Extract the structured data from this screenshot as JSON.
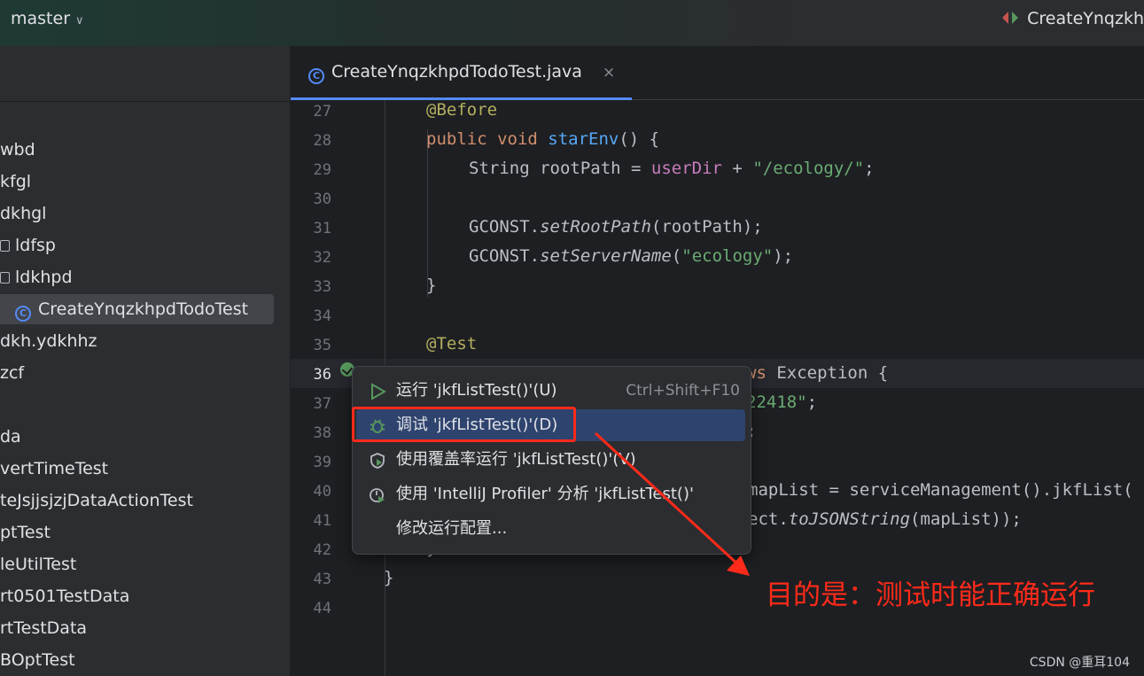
{
  "topbar": {
    "branch": "master",
    "run_config": "CreateYnqzkh"
  },
  "sidebar": {
    "items": [
      {
        "label": "wbd"
      },
      {
        "label": "kfgl"
      },
      {
        "label": "dkhgl"
      },
      {
        "label": "ldfsp"
      },
      {
        "label": "ldkhpd"
      },
      {
        "label": "CreateYnqzkhpdTodoTest",
        "selected": true
      },
      {
        "label": "dkh.ydkhhz"
      },
      {
        "label": "zcf"
      },
      {
        "label": "da"
      },
      {
        "label": "vertTimeTest"
      },
      {
        "label": "teJsjjsjzjDataActionTest"
      },
      {
        "label": "ptTest"
      },
      {
        "label": "leUtilTest"
      },
      {
        "label": "rt0501TestData"
      },
      {
        "label": "rtTestData"
      },
      {
        "label": "BOptTest"
      }
    ]
  },
  "tab": {
    "label": "CreateYnqzkhpdTodoTest.java",
    "close": "×"
  },
  "editor": {
    "line_numbers": [
      "27",
      "28",
      "29",
      "30",
      "31",
      "32",
      "33",
      "34",
      "35",
      "36",
      "37",
      "38",
      "39",
      "40",
      "41",
      "42",
      "43",
      "44"
    ],
    "line27": {
      "ann": "@Before"
    },
    "line28": {
      "kw": "public void ",
      "fn": "starEnv",
      "rest": "() {"
    },
    "line29": {
      "a": "String rootPath = ",
      "fld": "userDir",
      "b": " + ",
      "str": "\"/ecology/\"",
      "c": ";"
    },
    "line31": {
      "a": "GCONST.",
      "it": "setRootPath",
      "b": "(rootPath);"
    },
    "line32": {
      "a": "GCONST.",
      "it": "setServerName",
      "b": "(",
      "str": "\"ecology\"",
      "c": ");"
    },
    "line33": {
      "a": "}"
    },
    "line35": {
      "ann": "@Test"
    },
    "line36": {
      "kw": "ws ",
      "b": "Exception {"
    },
    "line37": {
      "str": "22418\"",
      "c": ";"
    },
    "line38": {
      "c": ";"
    },
    "line40": {
      "a": "mapList = serviceManagement().jkfList("
    },
    "line41": {
      "a": "ect.",
      "it": "toJSONString",
      "b": "(mapList));"
    },
    "line42": {
      "a": "}"
    },
    "line43": {
      "a": "}"
    }
  },
  "popup": {
    "run": {
      "label": "运行 'jkfListTest()'(U)",
      "shortcut": "Ctrl+Shift+F10",
      "icon": "play-icon"
    },
    "debug": {
      "label": "调试 'jkfListTest()'(D)",
      "icon": "bug-icon"
    },
    "coverage": {
      "label": "使用覆盖率运行 'jkfListTest()'(V)",
      "icon": "coverage-shield-icon"
    },
    "profiler": {
      "label": "使用 'IntelliJ Profiler' 分析 'jkfListTest()'",
      "icon": "profiler-clock-icon"
    },
    "modify": {
      "label": "修改运行配置..."
    }
  },
  "annotation": {
    "text": "目的是：测试时能正确运行",
    "color": "#ff2a1a"
  },
  "watermark": "CSDN @重耳104"
}
